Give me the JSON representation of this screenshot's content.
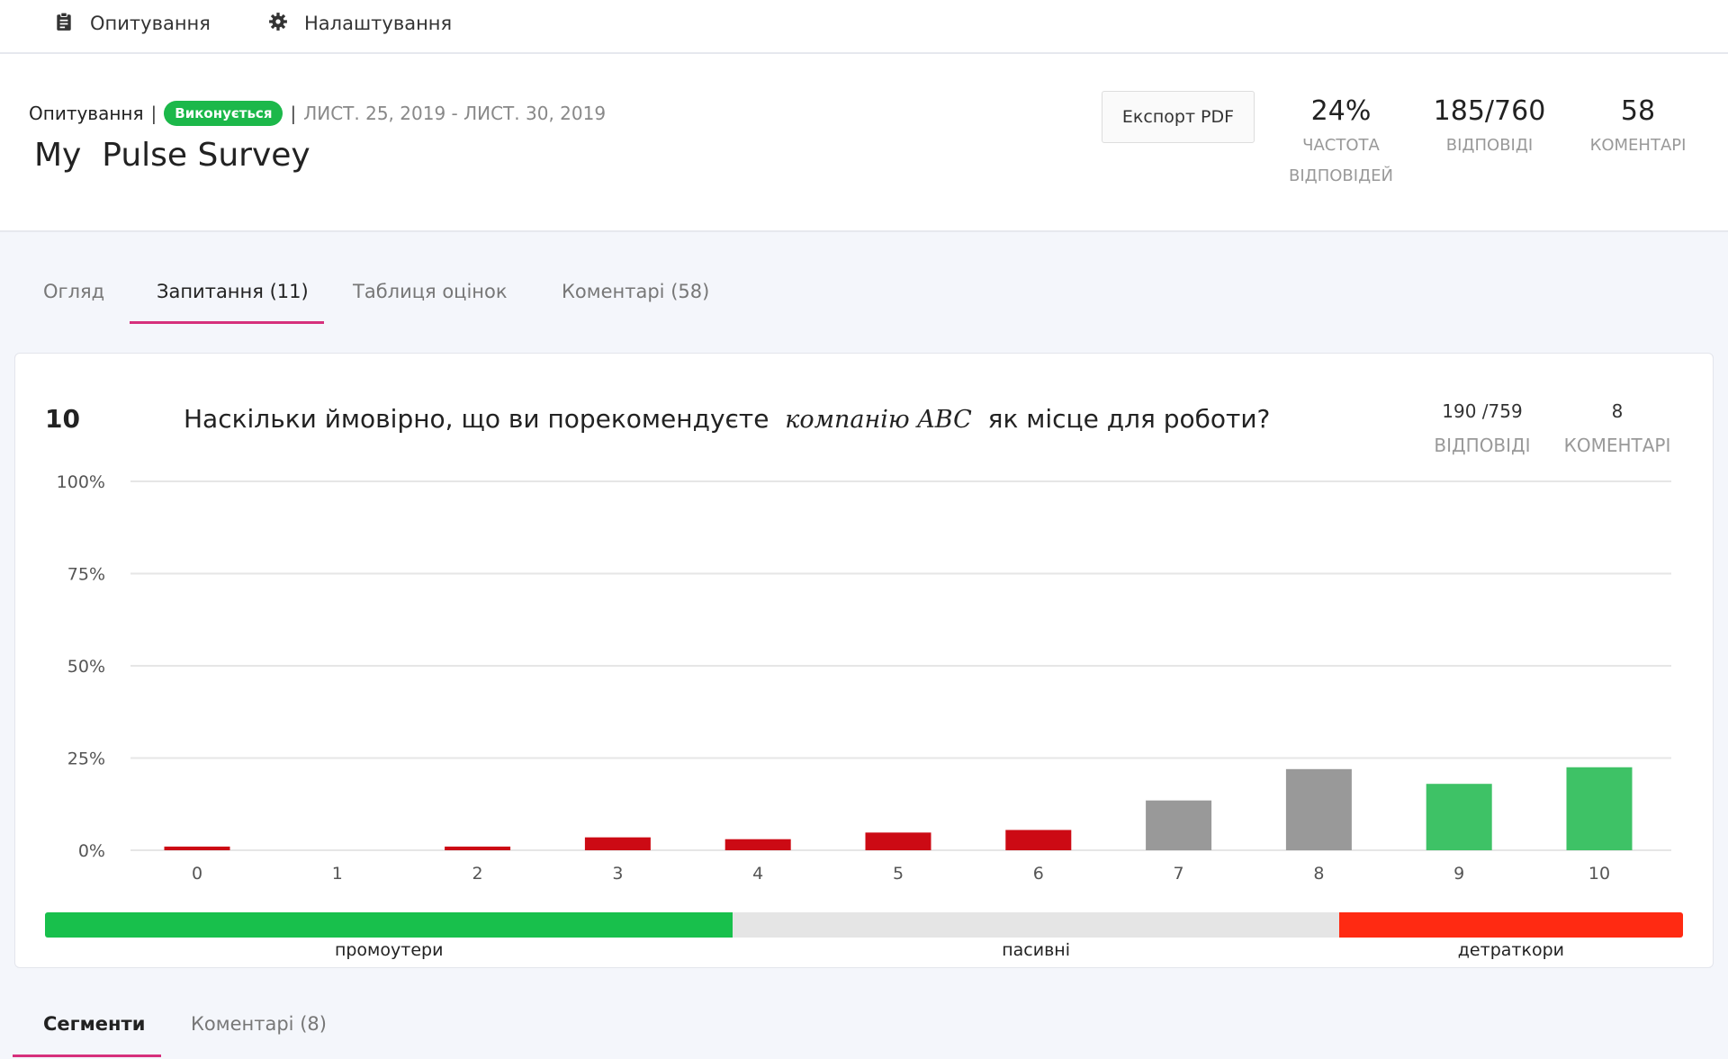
{
  "nav": {
    "surveys_label": "Опитування",
    "settings_label": "Налаштування"
  },
  "header": {
    "breadcrumb": "Опитування",
    "status": "Виконується",
    "dates": "ЛИСТ. 25, 2019 - ЛИСТ. 30, 2019",
    "title": "My  Pulse Survey",
    "export_label": "Експорт PDF",
    "stats": [
      {
        "value": "24%",
        "label_line1": "ЧАСТОТА",
        "label_line2": "ВІДПОВІДЕЙ"
      },
      {
        "value": "185/760",
        "label_line1": "ВІДПОВІДІ",
        "label_line2": ""
      },
      {
        "value": "58",
        "label_line1": "КОМЕНТАРІ",
        "label_line2": ""
      }
    ]
  },
  "tabs": [
    {
      "label": "Огляд"
    },
    {
      "label": "Запитання (11)"
    },
    {
      "label": "Таблиця оцінок"
    },
    {
      "label": "Коментарі (58)"
    }
  ],
  "question": {
    "number": "10",
    "text_before": "Наскільки ймовірно, що ви порекомендуєте",
    "text_italic": "компанію ABC",
    "text_after": "як місце для роботи?",
    "responses_value": "190 /759",
    "responses_label": "ВІДПОВІДІ",
    "comments_value": "8",
    "comments_label": "КОМЕНТАРІ"
  },
  "colors": {
    "detractor": "#cc0a14",
    "passive": "#999999",
    "promoter": "#3ec266",
    "accent": "#d6307c",
    "badge": "#1cb84a"
  },
  "chart_data": {
    "type": "bar",
    "categories": [
      "0",
      "1",
      "2",
      "3",
      "4",
      "5",
      "6",
      "7",
      "8",
      "9",
      "10"
    ],
    "values": [
      1,
      0,
      1,
      3.5,
      3,
      4.8,
      5.5,
      13.5,
      22,
      18,
      22.5
    ],
    "bar_groups": [
      "detractor",
      "detractor",
      "detractor",
      "detractor",
      "detractor",
      "detractor",
      "detractor",
      "passive",
      "passive",
      "promoter",
      "promoter"
    ],
    "y_ticks": [
      "100%",
      "75%",
      "50%",
      "25%",
      "0%"
    ],
    "ylim": [
      0,
      100
    ],
    "grid": true
  },
  "nps": {
    "segments": [
      {
        "label": "промоутери",
        "share": 0.42,
        "color": "#18c04c"
      },
      {
        "label": "пасивні",
        "share": 0.37,
        "color": "#e5e5e5"
      },
      {
        "label": "детраткори",
        "share": 0.21,
        "color": "#ff2a12"
      }
    ]
  },
  "subtabs": [
    {
      "label": "Сегменти"
    },
    {
      "label": "Коментарі (8)"
    }
  ]
}
